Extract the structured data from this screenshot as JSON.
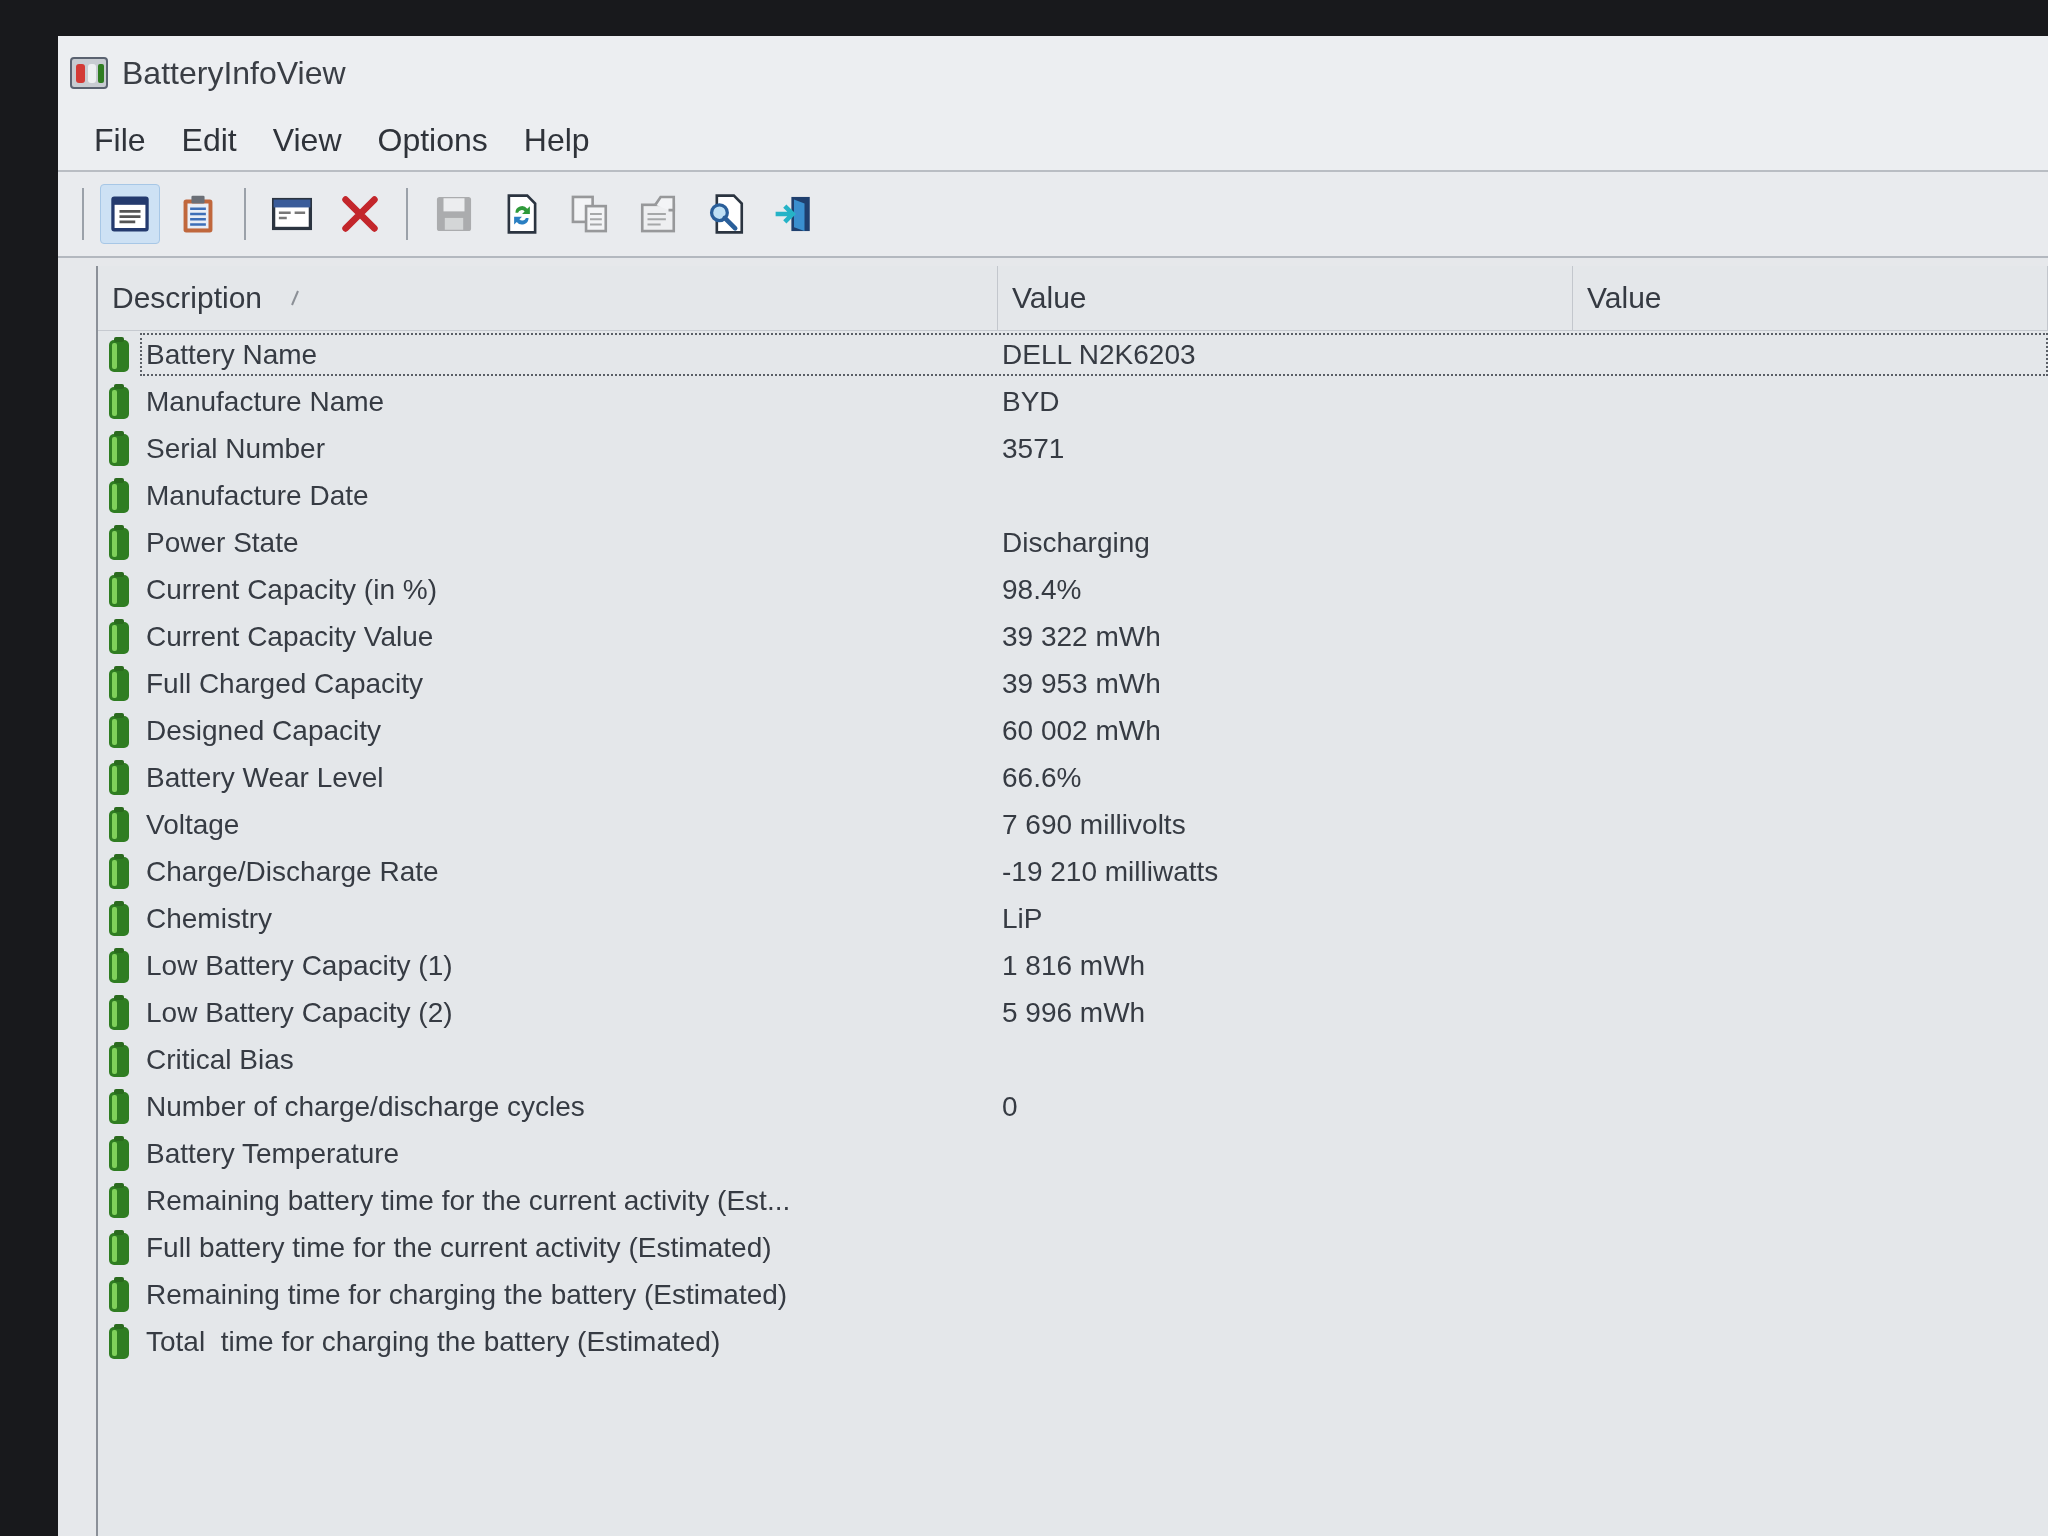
{
  "window": {
    "title": "BatteryInfoView"
  },
  "menu": [
    "File",
    "Edit",
    "View",
    "Options",
    "Help"
  ],
  "toolbar": [
    {
      "buttons": [
        {
          "kind": "details",
          "pressed": true,
          "disabled": false
        },
        {
          "kind": "report",
          "pressed": false,
          "disabled": false
        }
      ]
    },
    {
      "buttons": [
        {
          "kind": "html",
          "pressed": false,
          "disabled": false
        },
        {
          "kind": "delete",
          "pressed": false,
          "disabled": false
        }
      ]
    },
    {
      "buttons": [
        {
          "kind": "save",
          "pressed": false,
          "disabled": true
        },
        {
          "kind": "refresh",
          "pressed": false,
          "disabled": false
        },
        {
          "kind": "copy",
          "pressed": false,
          "disabled": true
        },
        {
          "kind": "properties",
          "pressed": false,
          "disabled": true
        },
        {
          "kind": "find",
          "pressed": false,
          "disabled": false
        },
        {
          "kind": "exit",
          "pressed": false,
          "disabled": false
        }
      ]
    }
  ],
  "columns": [
    {
      "label": "Description",
      "sorted": true
    },
    {
      "label": "Value",
      "sorted": false
    },
    {
      "label": "Value",
      "sorted": false
    }
  ],
  "rows": [
    {
      "description": "Battery Name",
      "value": "DELL N2K6203",
      "selected": true
    },
    {
      "description": "Manufacture Name",
      "value": "BYD",
      "selected": false
    },
    {
      "description": "Serial Number",
      "value": "3571",
      "selected": false
    },
    {
      "description": "Manufacture Date",
      "selected": false
    },
    {
      "description": "Power State",
      "value": "Discharging",
      "selected": false
    },
    {
      "description": "Current Capacity (in %)",
      "value": "98.4%",
      "selected": false
    },
    {
      "description": "Current Capacity Value",
      "value": "39 322 mWh",
      "selected": false
    },
    {
      "description": "Full Charged Capacity",
      "value": "39 953 mWh",
      "selected": false
    },
    {
      "description": "Designed Capacity",
      "value": "60 002 mWh",
      "selected": false
    },
    {
      "description": "Battery Wear Level",
      "value": "66.6%",
      "selected": false
    },
    {
      "description": "Voltage",
      "value": "7 690 millivolts",
      "selected": false
    },
    {
      "description": "Charge/Discharge Rate",
      "value": "-19 210 milliwatts",
      "selected": false
    },
    {
      "description": "Chemistry",
      "value": "LiP",
      "selected": false
    },
    {
      "description": "Low Battery Capacity (1)",
      "value": "1 816 mWh",
      "selected": false
    },
    {
      "description": "Low Battery Capacity (2)",
      "value": "5 996 mWh",
      "selected": false
    },
    {
      "description": "Critical Bias",
      "selected": false
    },
    {
      "description": "Number of charge/discharge cycles",
      "value": "0",
      "selected": false
    },
    {
      "description": "Battery Temperature",
      "selected": false
    },
    {
      "description": "Remaining battery time for the current activity (Est...",
      "selected": false
    },
    {
      "description": "Full battery time for the current activity (Estimated)",
      "selected": false
    },
    {
      "description": "Remaining time for charging the battery (Estimated)",
      "selected": false
    },
    {
      "description": "Total  time for charging the battery (Estimated)",
      "selected": false
    }
  ]
}
